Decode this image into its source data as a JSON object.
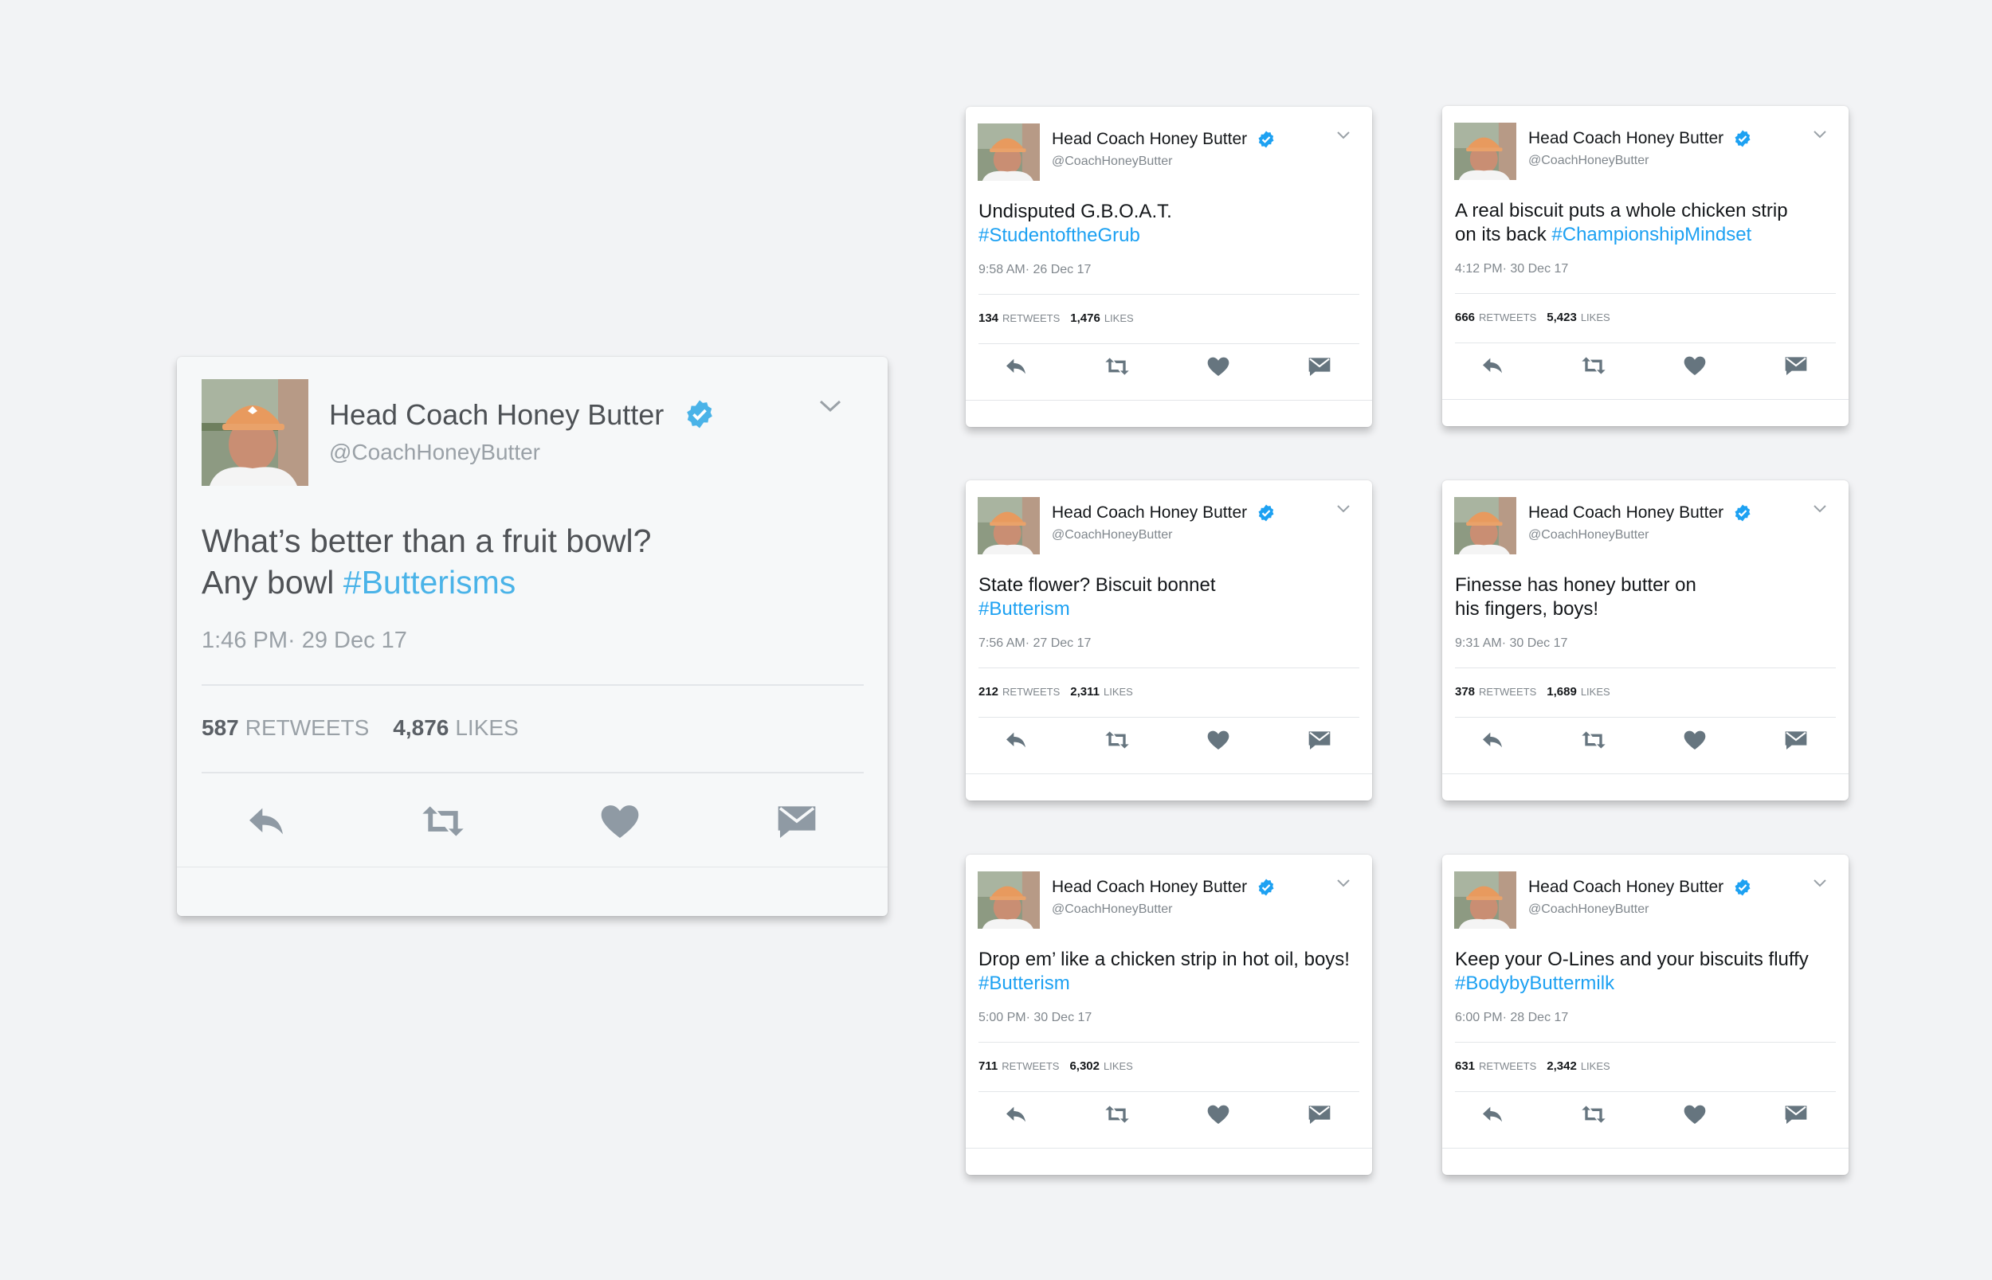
{
  "colors": {
    "hashtag": "#1da1f2",
    "verified": "#1da1f2",
    "action_icons": "#66757f",
    "background": "#f2f3f5"
  },
  "icons": {
    "verified": "verified-badge-icon",
    "caret": "chevron-down-icon",
    "reply": "reply-icon",
    "retweet": "retweet-icon",
    "like": "heart-icon",
    "message": "direct-message-icon"
  },
  "featured_tweet": {
    "author_name": "Head Coach Honey Butter",
    "handle": "@CoachHoneyButter",
    "text_line1": "What’s better than a fruit bowl?",
    "text_line2": "Any bowl ",
    "hashtag": "#Butterisms",
    "time": "1:46 PM",
    "date": "· 29 Dec 17",
    "retweets": "587",
    "retweets_label": "RETWEETS",
    "likes": "4,876",
    "likes_label": "LIKES"
  },
  "tweets": [
    {
      "author_name": "Head Coach Honey Butter",
      "handle": "@CoachHoneyButter",
      "text_line1": "Undisputed G.B.O.A.T.",
      "text_line2": "",
      "hashtag": "#StudentoftheGrub",
      "time": "9:58 AM",
      "date": "· 26 Dec 17",
      "retweets": "134",
      "retweets_label": "RETWEETS",
      "likes": "1,476",
      "likes_label": "LIKES"
    },
    {
      "author_name": "Head Coach Honey Butter",
      "handle": "@CoachHoneyButter",
      "text_line1": "A real biscuit puts a whole chicken strip",
      "text_line2": "on its back ",
      "hashtag": "#ChampionshipMindset",
      "time": "4:12 PM",
      "date": "· 30 Dec 17",
      "retweets": "666",
      "retweets_label": "RETWEETS",
      "likes": "5,423",
      "likes_label": "LIKES"
    },
    {
      "author_name": "Head Coach Honey Butter",
      "handle": "@CoachHoneyButter",
      "text_line1": "State flower? Biscuit bonnet",
      "text_line2": "",
      "hashtag": "#Butterism",
      "time": "7:56 AM",
      "date": "· 27 Dec 17",
      "retweets": "212",
      "retweets_label": "RETWEETS",
      "likes": "2,311",
      "likes_label": "LIKES"
    },
    {
      "author_name": "Head Coach Honey Butter",
      "handle": "@CoachHoneyButter",
      "text_line1": "Finesse has honey butter on",
      "text_line2": "his fingers, boys!",
      "hashtag": "",
      "time": "9:31 AM",
      "date": "· 30 Dec 17",
      "retweets": "378",
      "retweets_label": "RETWEETS",
      "likes": "1,689",
      "likes_label": "LIKES"
    },
    {
      "author_name": "Head Coach Honey Butter",
      "handle": "@CoachHoneyButter",
      "text_line1": "Drop em’ like a chicken strip in hot oil, boys!",
      "text_line2": "",
      "hashtag": "#Butterism",
      "time": "5:00 PM",
      "date": "· 30 Dec 17",
      "retweets": "711",
      "retweets_label": "RETWEETS",
      "likes": "6,302",
      "likes_label": "LIKES"
    },
    {
      "author_name": "Head Coach Honey Butter",
      "handle": "@CoachHoneyButter",
      "text_line1": "Keep your O-Lines and your biscuits fluffy",
      "text_line2": "",
      "hashtag": "#BodybyButtermilk",
      "time": "6:00 PM",
      "date": "· 28 Dec 17",
      "retweets": "631",
      "retweets_label": "RETWEETS",
      "likes": "2,342",
      "likes_label": "LIKES"
    }
  ]
}
